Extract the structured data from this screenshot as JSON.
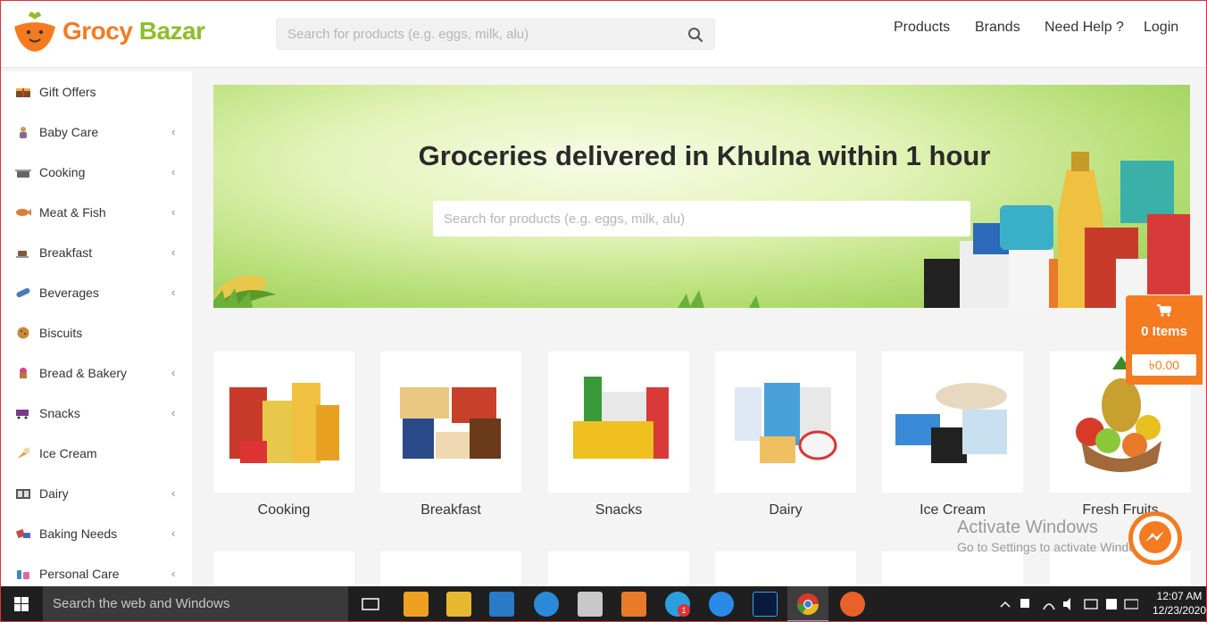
{
  "header": {
    "logo_part1": "Grocy",
    "logo_part2": "Bazar",
    "search_placeholder": "Search for products (e.g. eggs, milk, alu)",
    "nav": [
      "Products",
      "Brands",
      "Need Help ?",
      "Login"
    ]
  },
  "sidebar": {
    "items": [
      {
        "label": "Gift Offers",
        "icon": "gift-icon",
        "has_submenu": false
      },
      {
        "label": "Baby Care",
        "icon": "baby-icon",
        "has_submenu": true
      },
      {
        "label": "Cooking",
        "icon": "cooking-pot-icon",
        "has_submenu": true
      },
      {
        "label": "Meat & Fish",
        "icon": "fish-icon",
        "has_submenu": true
      },
      {
        "label": "Breakfast",
        "icon": "coffee-cup-icon",
        "has_submenu": true
      },
      {
        "label": "Beverages",
        "icon": "bottle-icon",
        "has_submenu": true
      },
      {
        "label": "Biscuits",
        "icon": "cookie-icon",
        "has_submenu": false
      },
      {
        "label": "Bread & Bakery",
        "icon": "cupcake-icon",
        "has_submenu": true
      },
      {
        "label": "Snacks",
        "icon": "snack-cart-icon",
        "has_submenu": true
      },
      {
        "label": "Ice Cream",
        "icon": "ice-cream-icon",
        "has_submenu": false
      },
      {
        "label": "Dairy",
        "icon": "dairy-icon",
        "has_submenu": true
      },
      {
        "label": "Baking Needs",
        "icon": "baking-icon",
        "has_submenu": true
      },
      {
        "label": "Personal Care",
        "icon": "personal-care-icon",
        "has_submenu": true
      }
    ]
  },
  "banner": {
    "title": "Groceries delivered in Khulna within 1 hour",
    "search_placeholder": "Search for products (e.g. eggs, milk, alu)"
  },
  "categories": [
    "Cooking",
    "Breakfast",
    "Snacks",
    "Dairy",
    "Ice Cream",
    "Fresh Fruits"
  ],
  "cart": {
    "items_label": "0 Items",
    "total": "৳0.00",
    "icon": "shopping-cart-icon"
  },
  "watermark": {
    "title": "Activate Windows",
    "subtitle": "Go to Settings to activate Windows."
  },
  "taskbar": {
    "search_text": "Search the web and Windows",
    "time": "12:07 AM",
    "date": "12/23/2020",
    "skype_badge": "1"
  },
  "colors": {
    "brand_orange": "#f47b20",
    "brand_green": "#8cbf26",
    "taskbar": "#1f1f1f"
  }
}
